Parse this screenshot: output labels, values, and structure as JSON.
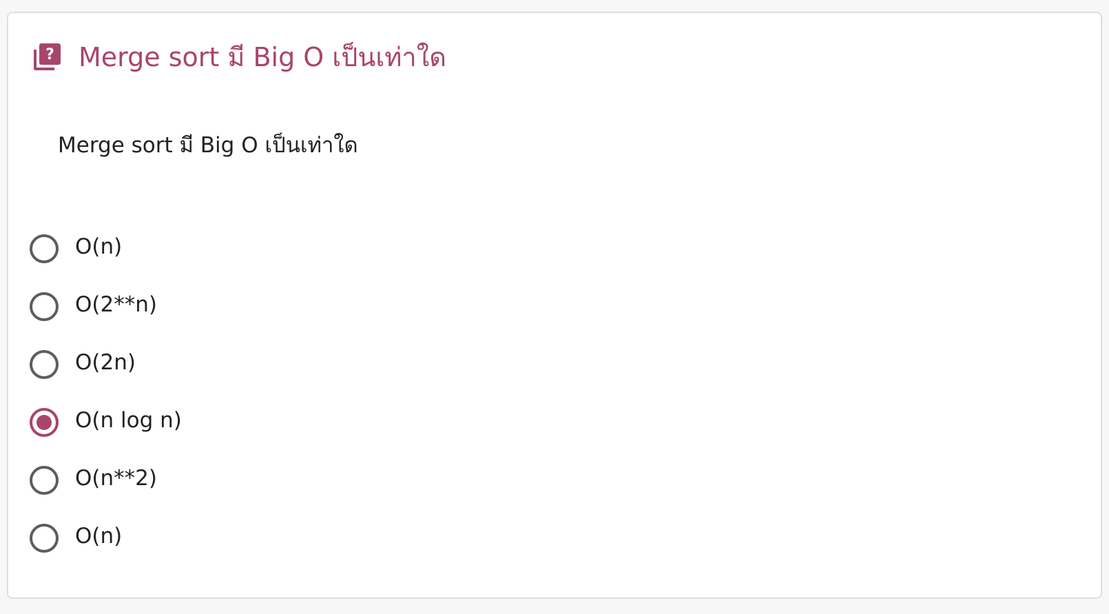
{
  "quiz": {
    "title": "Merge sort มี Big O เป็นเท่าใด",
    "header_icon": "quiz-library-icon",
    "question": "Merge sort มี Big O เป็นเท่าใด",
    "accent_color": "#a8456b",
    "options": [
      {
        "label": "O(n)",
        "selected": false
      },
      {
        "label": "O(2**n)",
        "selected": false
      },
      {
        "label": "O(2n)",
        "selected": false
      },
      {
        "label": "O(n log n)",
        "selected": true
      },
      {
        "label": "O(n**2)",
        "selected": false
      },
      {
        "label": "O(n)",
        "selected": false
      }
    ]
  }
}
